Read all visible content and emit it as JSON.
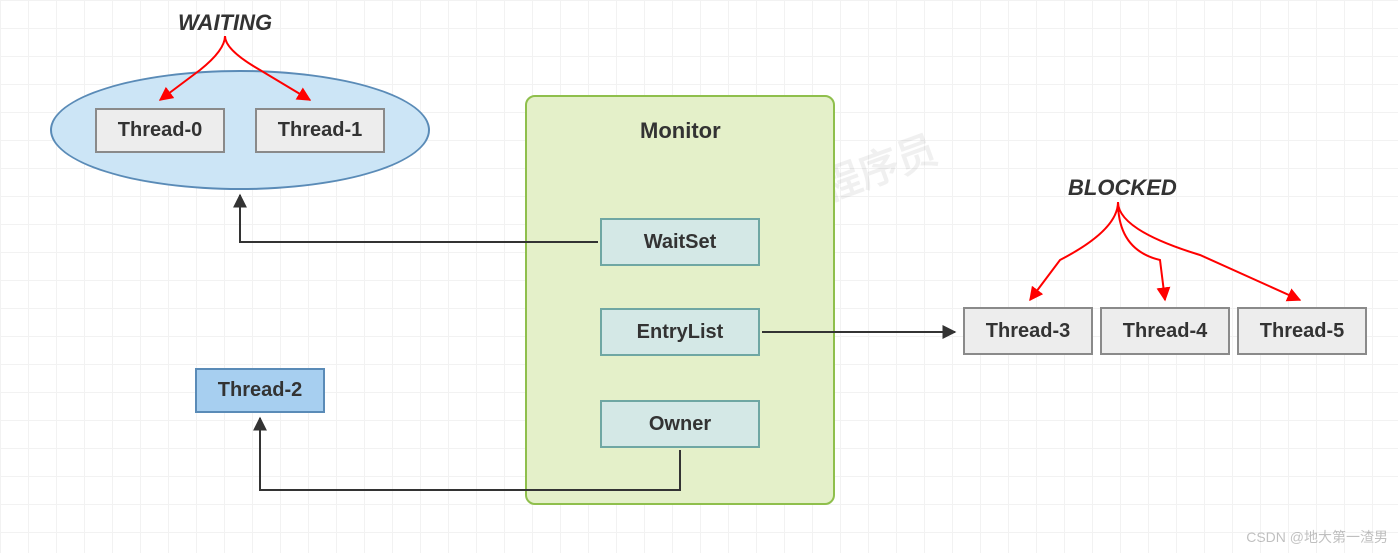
{
  "states": {
    "waiting": "WAITING",
    "blocked": "BLOCKED"
  },
  "threads": {
    "t0": "Thread-0",
    "t1": "Thread-1",
    "t2": "Thread-2",
    "t3": "Thread-3",
    "t4": "Thread-4",
    "t5": "Thread-5"
  },
  "monitor": {
    "title": "Monitor",
    "waitset": "WaitSet",
    "entrylist": "EntryList",
    "owner": "Owner"
  },
  "watermark": "黑马程序员",
  "credit": "CSDN @地大第一渣男"
}
